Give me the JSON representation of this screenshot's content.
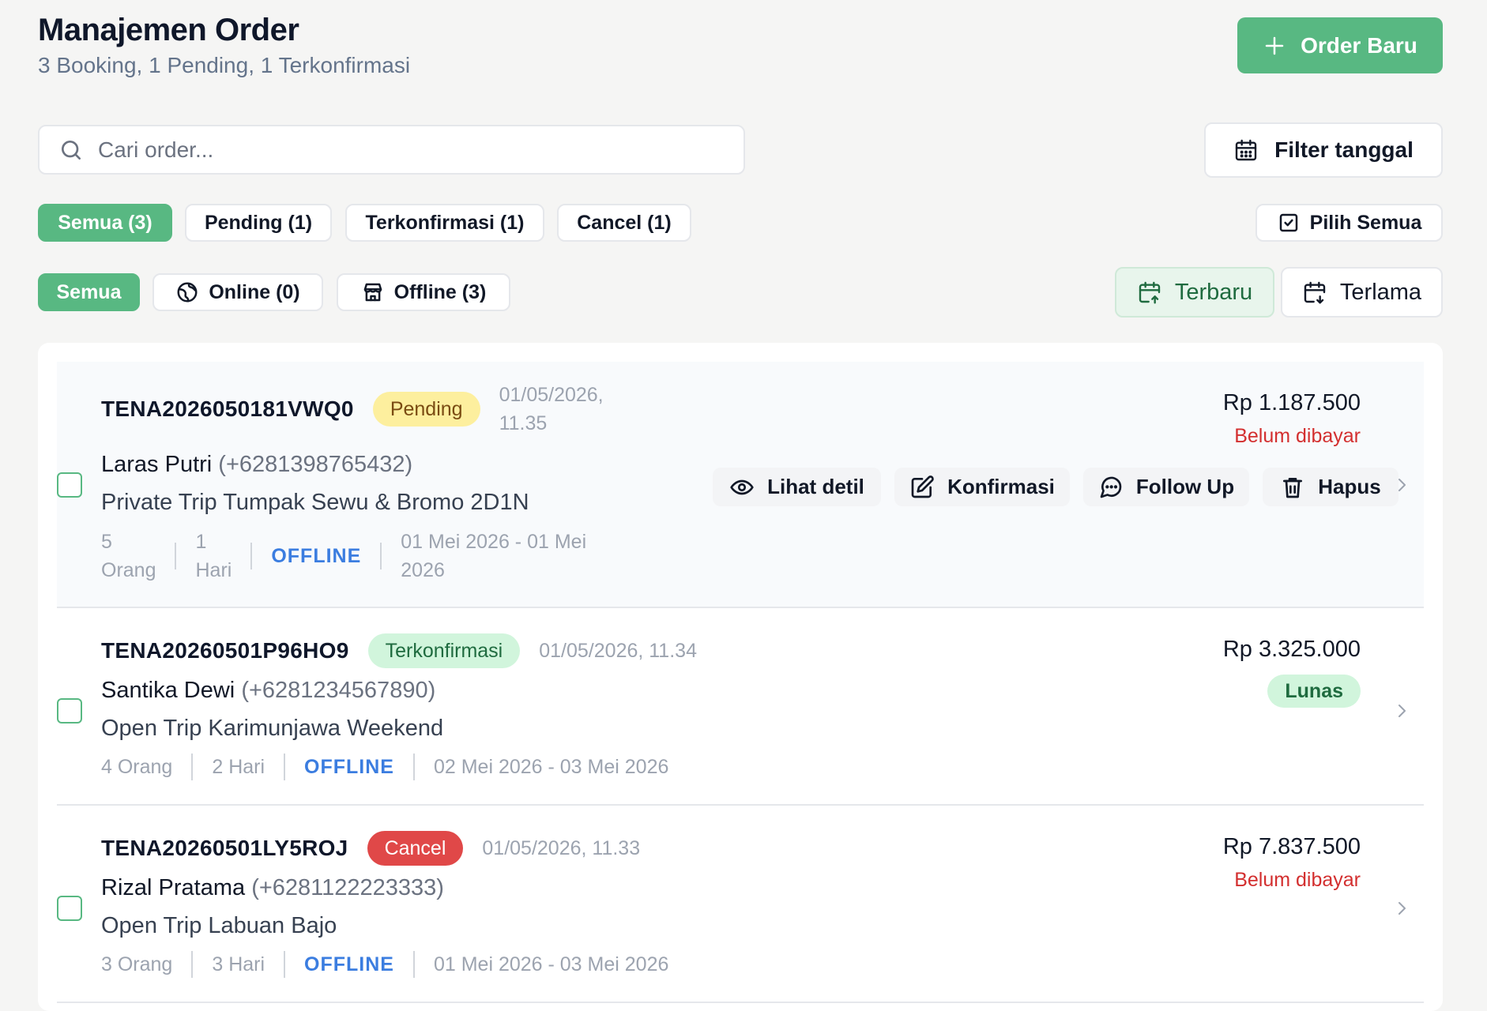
{
  "header": {
    "title": "Manajemen Order",
    "subtitle": "3 Booking, 1 Pending, 1 Terkonfirmasi",
    "new_order_label": "Order Baru"
  },
  "search": {
    "placeholder": "Cari order...",
    "value": ""
  },
  "filter_date_label": "Filter tanggal",
  "status_filters": [
    {
      "label": "Semua (3)",
      "active": true
    },
    {
      "label": "Pending (1)",
      "active": false
    },
    {
      "label": "Terkonfirmasi (1)",
      "active": false
    },
    {
      "label": "Cancel (1)",
      "active": false
    }
  ],
  "select_all_label": "Pilih Semua",
  "source_filters": [
    {
      "label": "Semua",
      "active": true
    },
    {
      "label": "Online (0)",
      "icon": "globe-icon",
      "active": false
    },
    {
      "label": "Offline (3)",
      "icon": "store-icon",
      "active": false
    }
  ],
  "sort": {
    "newest_label": "Terbaru",
    "oldest_label": "Terlama",
    "active": "newest"
  },
  "orders": [
    {
      "id": "TENA2026050181VWQ0",
      "status": "Pending",
      "date_line1": "01/05/2026,",
      "date_line2": "11.35",
      "customer_name": "Laras Putri",
      "customer_phone": "(+6281398765432)",
      "trip": "Private Trip Tumpak Sewu & Bromo 2D1N",
      "pax_line1": "5",
      "pax_line2": "Orang",
      "days_line1": "1",
      "days_line2": "Hari",
      "source": "OFFLINE",
      "range_line1": "01 Mei 2026 - 01 Mei",
      "range_line2": "2026",
      "price": "Rp 1.187.500",
      "payment": "Belum dibayar",
      "actions": {
        "view": "Lihat detil",
        "confirm": "Konfirmasi",
        "follow_up": "Follow Up",
        "delete": "Hapus"
      }
    },
    {
      "id": "TENA20260501P96HO9",
      "status": "Terkonfirmasi",
      "date": "01/05/2026, 11.34",
      "customer_name": "Santika Dewi",
      "customer_phone": "(+6281234567890)",
      "trip": "Open Trip Karimunjawa Weekend",
      "pax": "4 Orang",
      "days": "2 Hari",
      "source": "OFFLINE",
      "range": "02 Mei 2026 - 03 Mei 2026",
      "price": "Rp 3.325.000",
      "payment": "Lunas"
    },
    {
      "id": "TENA20260501LY5ROJ",
      "status": "Cancel",
      "date": "01/05/2026, 11.33",
      "customer_name": "Rizal Pratama",
      "customer_phone": "(+6281122223333)",
      "trip": "Open Trip Labuan Bajo",
      "pax": "3 Orang",
      "days": "3 Hari",
      "source": "OFFLINE",
      "range": "01 Mei 2026 - 03 Mei 2026",
      "price": "Rp 7.837.500",
      "payment": "Belum dibayar"
    }
  ],
  "colors": {
    "accent": "#58b882",
    "pending_badge": "#fdef9e",
    "confirmed_badge": "#d1f5dc",
    "cancel_badge": "#e04848",
    "unpaid_text": "#d32f2f",
    "source_text": "#3b7de0"
  }
}
